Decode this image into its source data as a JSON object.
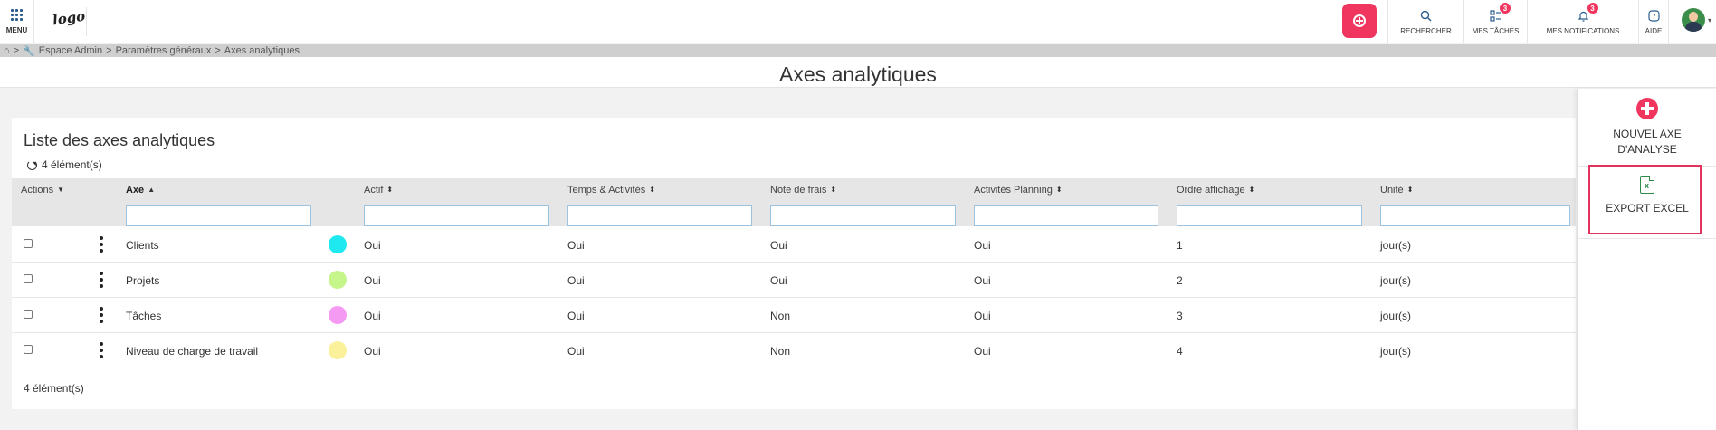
{
  "topbar": {
    "menu_label": "MENU",
    "logo_text": "logo",
    "tools": [
      {
        "label": "RECHERCHER",
        "icon": "search-icon"
      },
      {
        "label": "MES TÂCHES",
        "icon": "tasks-icon",
        "badge": "3"
      },
      {
        "label": "MES NOTIFICATIONS",
        "icon": "bell-icon",
        "badge": "3"
      },
      {
        "label": "AIDE",
        "icon": "help-icon"
      }
    ],
    "accent_color": "#f0365f"
  },
  "breadcrumb": {
    "separator": ">",
    "items": [
      "Espace Admin",
      "Paramètres généraux",
      "Axes analytiques"
    ]
  },
  "page": {
    "title": "Axes analytiques"
  },
  "list": {
    "title": "Liste des axes analytiques",
    "count_label": "4 élément(s)",
    "footer_count": "4 élément(s)",
    "columns": [
      {
        "key": "actions",
        "label": "Actions"
      },
      {
        "key": "axe",
        "label": "Axe"
      },
      {
        "key": "actif",
        "label": "Actif"
      },
      {
        "key": "temps",
        "label": "Temps & Activités"
      },
      {
        "key": "frais",
        "label": "Note de frais"
      },
      {
        "key": "planning",
        "label": "Activités Planning"
      },
      {
        "key": "ordre",
        "label": "Ordre affichage"
      },
      {
        "key": "unite",
        "label": "Unité"
      }
    ],
    "rows": [
      {
        "axe": "Clients",
        "color": "#1ee8f0",
        "actif": "Oui",
        "temps": "Oui",
        "frais": "Oui",
        "planning": "Oui",
        "ordre": "1",
        "unite": "jour(s)"
      },
      {
        "axe": "Projets",
        "color": "#c6f58c",
        "actif": "Oui",
        "temps": "Oui",
        "frais": "Oui",
        "planning": "Oui",
        "ordre": "2",
        "unite": "jour(s)"
      },
      {
        "axe": "Tâches",
        "color": "#f59af2",
        "actif": "Oui",
        "temps": "Oui",
        "frais": "Non",
        "planning": "Oui",
        "ordre": "3",
        "unite": "jour(s)"
      },
      {
        "axe": "Niveau de charge de travail",
        "color": "#faf19a",
        "actif": "Oui",
        "temps": "Oui",
        "frais": "Non",
        "planning": "Oui",
        "ordre": "4",
        "unite": "jour(s)"
      }
    ]
  },
  "side_panel": {
    "new_axis_line1": "NOUVEL AXE",
    "new_axis_line2": "D'ANALYSE",
    "export_label": "EXPORT EXCEL",
    "highlight_color": "#e0345e"
  }
}
